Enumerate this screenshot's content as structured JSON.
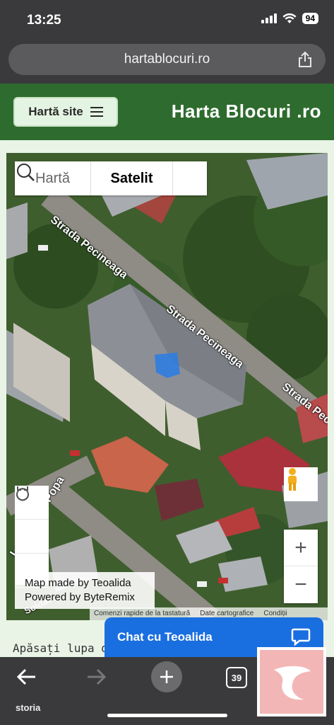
{
  "status_bar": {
    "time": "13:25",
    "battery": "94"
  },
  "browser": {
    "url": "hartablocuri.ro",
    "tab_count": "39",
    "brand": "storia"
  },
  "site": {
    "menu_label": "Hartă site",
    "title": "Harta Blocuri .ro"
  },
  "map": {
    "tabs": {
      "map": "Hartă",
      "satellite": "Satelit"
    },
    "streets": [
      "Strada Pecineaga",
      "Strada Pecineaga",
      "Strada Pecineaga",
      "Locotenent Popa",
      "Soldat..."
    ],
    "credit": {
      "line1": "Map made by Teoalida",
      "line2": "Powered by ByteRemix"
    },
    "footer": {
      "shortcuts": "Comenzi rapide de la tastatură",
      "data": "Date cartografice",
      "terms": "Condiții"
    },
    "zoom_in": "+",
    "zoom_out": "−",
    "highlight_color": "#2f7de0"
  },
  "page": {
    "instruction": "Apăsați lupa di"
  },
  "chat": {
    "label": "Chat cu Teoalida"
  },
  "colors": {
    "header_green": "#2e6b2e",
    "chat_blue": "#1a6fe0",
    "background": "#e9f4e6"
  }
}
